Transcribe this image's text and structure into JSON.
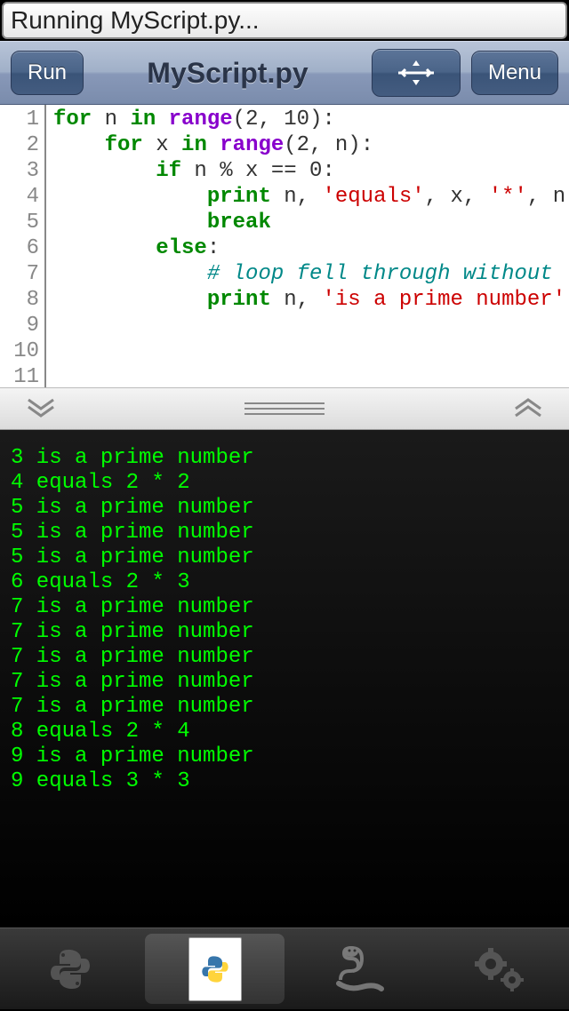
{
  "status": {
    "text": "Running MyScript.py..."
  },
  "toolbar": {
    "run_label": "Run",
    "title": "MyScript.py",
    "menu_label": "Menu"
  },
  "editor": {
    "line_numbers": [
      "1",
      "2",
      "3",
      "4",
      "5",
      "6",
      "7",
      "8",
      "9",
      "10",
      "11"
    ],
    "tokens": [
      [
        {
          "c": "kw",
          "t": "for"
        },
        {
          "c": "",
          "t": " n "
        },
        {
          "c": "kw",
          "t": "in"
        },
        {
          "c": "",
          "t": " "
        },
        {
          "c": "fn",
          "t": "range"
        },
        {
          "c": "",
          "t": "(2, 10):"
        }
      ],
      [
        {
          "c": "",
          "t": "    "
        },
        {
          "c": "kw",
          "t": "for"
        },
        {
          "c": "",
          "t": " x "
        },
        {
          "c": "kw",
          "t": "in"
        },
        {
          "c": "",
          "t": " "
        },
        {
          "c": "fn",
          "t": "range"
        },
        {
          "c": "",
          "t": "(2, n):"
        }
      ],
      [
        {
          "c": "",
          "t": "        "
        },
        {
          "c": "kw",
          "t": "if"
        },
        {
          "c": "",
          "t": " n % x == 0:"
        }
      ],
      [
        {
          "c": "",
          "t": "            "
        },
        {
          "c": "kw",
          "t": "print"
        },
        {
          "c": "",
          "t": " n, "
        },
        {
          "c": "str",
          "t": "'equals'"
        },
        {
          "c": "",
          "t": ", x, "
        },
        {
          "c": "str",
          "t": "'*'"
        },
        {
          "c": "",
          "t": ", n"
        }
      ],
      [
        {
          "c": "",
          "t": "            "
        },
        {
          "c": "kw",
          "t": "break"
        }
      ],
      [
        {
          "c": "",
          "t": "        "
        },
        {
          "c": "kw",
          "t": "else"
        },
        {
          "c": "",
          "t": ":"
        }
      ],
      [
        {
          "c": "",
          "t": "            "
        },
        {
          "c": "cmt",
          "t": "# loop fell through without "
        }
      ],
      [
        {
          "c": "",
          "t": "            "
        },
        {
          "c": "kw",
          "t": "print"
        },
        {
          "c": "",
          "t": " n, "
        },
        {
          "c": "str",
          "t": "'is a prime number'"
        }
      ],
      [],
      []
    ]
  },
  "console_output": "3 is a prime number\n4 equals 2 * 2\n5 is a prime number\n5 is a prime number\n5 is a prime number\n6 equals 2 * 3\n7 is a prime number\n7 is a prime number\n7 is a prime number\n7 is a prime number\n7 is a prime number\n8 equals 2 * 4\n9 is a prime number\n9 equals 3 * 3",
  "tabs": {
    "active_index": 1
  }
}
